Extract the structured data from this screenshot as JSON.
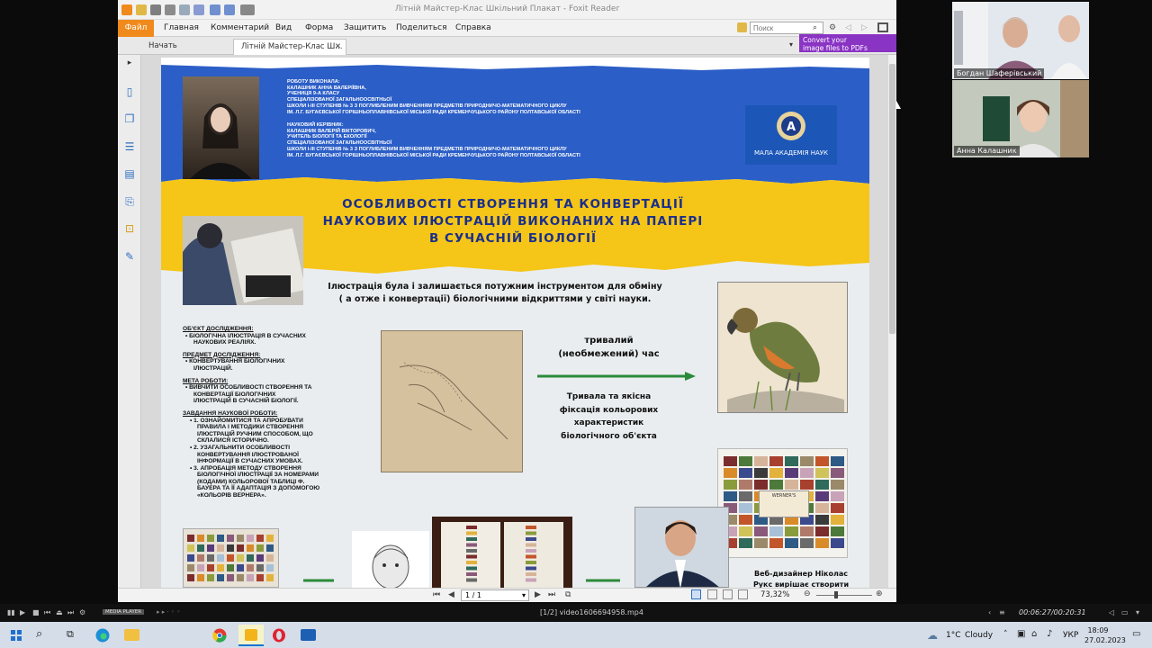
{
  "app": {
    "title": "Літній Майстер-Клас Шкільний Плакат - Foxit Reader"
  },
  "menu": {
    "file": "Файл",
    "items": [
      "Главная",
      "Комментарий",
      "Вид",
      "Форма",
      "Защитить",
      "Поделиться",
      "Справка"
    ]
  },
  "search": {
    "placeholder": "Поиск"
  },
  "tabs": [
    {
      "label": "Начать"
    },
    {
      "label": "Літній Майстер-Клас Ш..."
    }
  ],
  "promo": {
    "line1": "Convert your",
    "line2": "image files to PDFs"
  },
  "poster": {
    "authors_block1": [
      "РОБОТУ ВИКОНАЛА:",
      "КАЛАШНИК АННА ВАЛЕРІЇВНА,",
      "УЧЕНИЦЯ 9-А КЛАСУ",
      "СПЕЦІАЛІЗОВАНОЇ ЗАГАЛЬНООСВІТНЬОЇ",
      "ШКОЛИ І-ІІІ СТУПЕНІВ № 3 З ПОГЛИБЛЕНИМ ВИВЧЕННЯМ ПРЕДМЕТІВ ПРИРОДНИЧО-МАТЕМАТИЧНОГО ЦИКЛУ",
      "ІМ. Л.Г. БУГАЄВСЬКОЇ ГОРІШНЬОПЛАВНІВСЬКОЇ МІСЬКОЇ РАДИ КРЕМЕНЧУЦЬКОГО РАЙОНУ ПОЛТАВСЬКОЇ ОБЛАСТІ"
    ],
    "authors_block2": [
      "НАУКОВИЙ КЕРІВНИК:",
      "КАЛАШНИК ВАЛЕРІЙ ВІКТОРОВИЧ,",
      "УЧИТЕЛЬ БІОЛОГІЇ ТА ЕКОЛОГІЇ",
      "СПЕЦІАЛІЗОВАНОЇ ЗАГАЛЬНООСВІТНЬОЇ",
      "ШКОЛИ І-ІІІ СТУПЕНІВ № 3 З ПОГЛИБЛЕНИМ ВИВЧЕННЯМ ПРЕДМЕТІВ ПРИРОДНИЧО-МАТЕМАТИЧНОГО ЦИКЛУ",
      "ІМ. Л.Г. БУГАЄВСЬКОЇ ГОРІШНЬОПЛАВНІВСЬКОЇ МІСЬКОЇ РАДИ КРЕМЕНЧУЦЬКОГО РАЙОНУ ПОЛТАВСЬКОЇ ОБЛАСТІ"
    ],
    "man_logo": "МАЛА АКАДЕМІЯ НАУК",
    "title": [
      "ОСОБЛИВОСТІ СТВОРЕННЯ ТА КОНВЕРТАЦІЇ",
      "НАУКОВИХ ІЛЮСТРАЦІЙ ВИКОНАНИХ НА ПАПЕРІ",
      "В СУЧАСНІЙ БІОЛОГІЇ"
    ],
    "intro": [
      "Ілюстрація була і залишається потужним інструментом для обміну",
      "( а отже і конвертації) біологічними відкриттями у світі науки."
    ],
    "object_heading": "ОБ'ЄКТ ДОСЛІДЖЕННЯ:",
    "object_text": [
      "• БІОЛОГІЧНА ІЛЮСТРАЦІЯ В СУЧАСНИХ",
      "НАУКОВИХ РЕАЛІЯХ."
    ],
    "subject_heading": "ПРЕДМЕТ ДОСЛІДЖЕННЯ:",
    "subject_text": [
      "• КОНВЕРТУВАННЯ БІОЛОГІЧНИХ",
      "ІЛЮСТРАЦІЙ."
    ],
    "goal_heading": "МЕТА РОБОТИ:",
    "goal_text": [
      "• ВИВЧИТИ ОСОБЛИВОСТІ СТВОРЕННЯ ТА",
      "КОНВЕРТАЦІЇ БІОЛОГІЧНИХ",
      "ІЛЮСТРАЦІЙ В СУЧАСНІЙ БІОЛОГІЇ."
    ],
    "tasks_heading": "ЗАВДАННЯ НАУКОВОЇ РОБОТИ:",
    "tasks_text": [
      "• 1. ОЗНАЙОМИТИСЯ ТА АПРОБУВАТИ",
      "ПРАВИЛА І МЕТОДИКИ СТВОРЕННЯ",
      "ІЛЮСТРАЦІЙ РУЧНИМ СПОСОБОМ, ЩО",
      "СКЛАЛИСЯ ІСТОРИЧНО.",
      "• 2. УЗАГАЛЬНИТИ ОСОБЛИВОСТІ",
      "КОНВЕРТУВАННЯ ІЛЮСТРОВАНОЇ",
      "ІНФОРМАЦІЇ В СУЧАСНИХ УМОВАХ.",
      "• 3. АПРОБАЦІЯ МЕТОДУ СТВОРЕННЯ",
      "БІОЛОГІЧНОЇ ІЛЮСТРАЦІЇ ЗА НОМЕРАМИ",
      "(КОДАМИ) КОЛЬОРОВОЇ ТАБЛИЦІ Ф.",
      "БАУЕРА ТА ЇЇ АДАПТАЦІЯ З ДОПОМОГОЮ",
      "«КОЛЬОРІВ ВЕРНЕРА»."
    ],
    "long_time": [
      "тривалий",
      "(необмежений) час"
    ],
    "fixation": [
      "Тривала та якісна",
      "фіксація кольорових",
      "характеристик",
      "біологічного об'єкта"
    ],
    "designer": [
      "Веб-дизайнер Ніколас",
      "Рукс вирішає створити"
    ],
    "werner_label": "WERNER'S"
  },
  "status": {
    "page": "1 / 1",
    "zoom": "73,32%"
  },
  "participants": [
    {
      "name": "Богдан Шаферівський"
    },
    {
      "name": "Анна Калашник"
    }
  ],
  "player": {
    "logo": "MEDIA PLAYER",
    "file": "[1/2] video1606694958.mp4",
    "time": "00:06:27/00:20:31"
  },
  "taskbar": {
    "weather_temp": "1°C",
    "weather_desc": "Cloudy",
    "lang": "УКР",
    "clock": "18:09",
    "date": "27.02.2023"
  }
}
